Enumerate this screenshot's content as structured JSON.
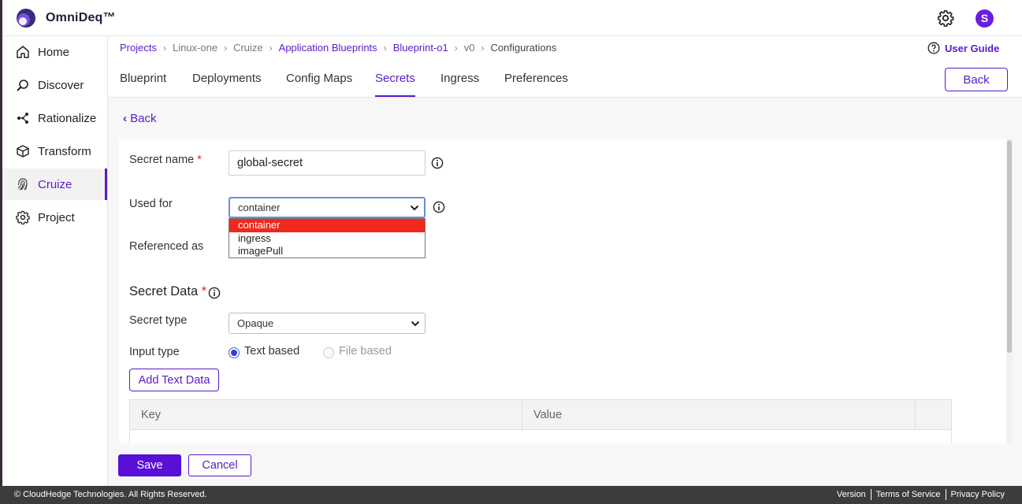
{
  "app": {
    "name": "OmniDeq™",
    "avatar_letter": "S",
    "accent": "#5a1ac9"
  },
  "icons": {
    "settings": "gear-icon",
    "user_guide": "question-circle-icon",
    "info": "info-circle-icon",
    "back": "chevron-left-icon",
    "select": "chevron-down-icon"
  },
  "sidebar": {
    "items": [
      {
        "label": "Home",
        "icon": "home-icon"
      },
      {
        "label": "Discover",
        "icon": "magnify-icon"
      },
      {
        "label": "Rationalize",
        "icon": "nodes-icon"
      },
      {
        "label": "Transform",
        "icon": "cube-icon"
      },
      {
        "label": "Cruize",
        "icon": "fingerprint-icon",
        "active": true
      },
      {
        "label": "Project",
        "icon": "cog-icon"
      }
    ]
  },
  "breadcrumb": [
    "Projects",
    "Linux-one",
    "Cruize",
    "Application Blueprints",
    "Blueprint-o1",
    "v0",
    "Configurations"
  ],
  "user_guide": "User Guide",
  "tabs": [
    "Blueprint",
    "Deployments",
    "Config Maps",
    "Secrets",
    "Ingress",
    "Preferences"
  ],
  "active_tab": "Secrets",
  "back_button": "Back",
  "back_link": "Back",
  "form": {
    "secret_name_label": "Secret name",
    "required_mark": "*",
    "secret_name_value": "global-secret",
    "used_for_label": "Used for",
    "used_for_value": "container",
    "used_for_options": [
      "container",
      "ingress",
      "imagePull"
    ],
    "referenced_as_label": "Referenced as",
    "secret_data_title": "Secret Data",
    "secret_type_label": "Secret type",
    "secret_type_value": "Opaque",
    "input_type_label": "Input type",
    "input_type_options": [
      "Text based",
      "File based"
    ],
    "input_type_selected": "Text based",
    "add_text_data": "Add Text Data",
    "table_headers": [
      "Key",
      "Value"
    ]
  },
  "actions": {
    "save": "Save",
    "cancel": "Cancel"
  },
  "footer": {
    "copyright": "© CloudHedge Technologies. All Rights Reserved.",
    "links": [
      "Version",
      "Terms of Service",
      "Privacy Policy"
    ]
  }
}
